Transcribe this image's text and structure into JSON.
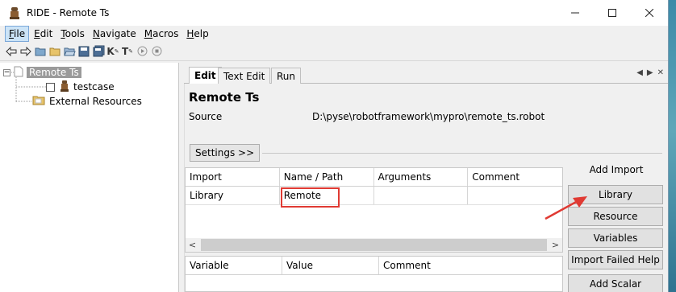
{
  "window": {
    "title": "RIDE - Remote Ts",
    "minimize_label": "—",
    "maximize_label": "☐",
    "close_label": "✕"
  },
  "menu": {
    "items": [
      {
        "mnemonic": "F",
        "rest": "ile"
      },
      {
        "mnemonic": "E",
        "rest": "dit"
      },
      {
        "mnemonic": "T",
        "rest": "ools"
      },
      {
        "mnemonic": "N",
        "rest": "avigate"
      },
      {
        "mnemonic": "M",
        "rest": "acros"
      },
      {
        "mnemonic": "H",
        "rest": "elp"
      }
    ]
  },
  "toolbar": {
    "icons": [
      "arrow-left-icon",
      "arrow-right-icon",
      "open-folder-icon",
      "folder-icon",
      "folder-open-icon",
      "save-icon",
      "save-all-icon",
      "keyword-search-icon",
      "test-search-icon",
      "run-icon",
      "stop-icon"
    ],
    "keyword_glyph": "K",
    "test_glyph": "T"
  },
  "tree": {
    "root": "Remote Ts",
    "child": "testcase",
    "external": "External Resources",
    "expander": "−"
  },
  "tabs": [
    {
      "label": "Edit"
    },
    {
      "label": "Text Edit"
    },
    {
      "label": "Run"
    }
  ],
  "editor": {
    "suite_name": "Remote Ts",
    "source_label": "Source",
    "source_path": "D:\\pyse\\robotframework\\mypro\\remote_ts.robot",
    "settings_label": "Settings >>"
  },
  "imports_table": {
    "columns": [
      "Import",
      "Name / Path",
      "Arguments",
      "Comment"
    ],
    "rows": [
      [
        "Library",
        "Remote",
        "",
        ""
      ]
    ]
  },
  "variables_table": {
    "columns": [
      "Variable",
      "Value",
      "Comment"
    ]
  },
  "side_buttons": {
    "add_import_label": "Add Import",
    "library": "Library",
    "resource": "Resource",
    "variables": "Variables",
    "import_failed_help": "Import Failed Help",
    "add_scalar": "Add Scalar"
  },
  "colors": {
    "highlight": "#e03a33",
    "selection": "#9a9a9a"
  }
}
